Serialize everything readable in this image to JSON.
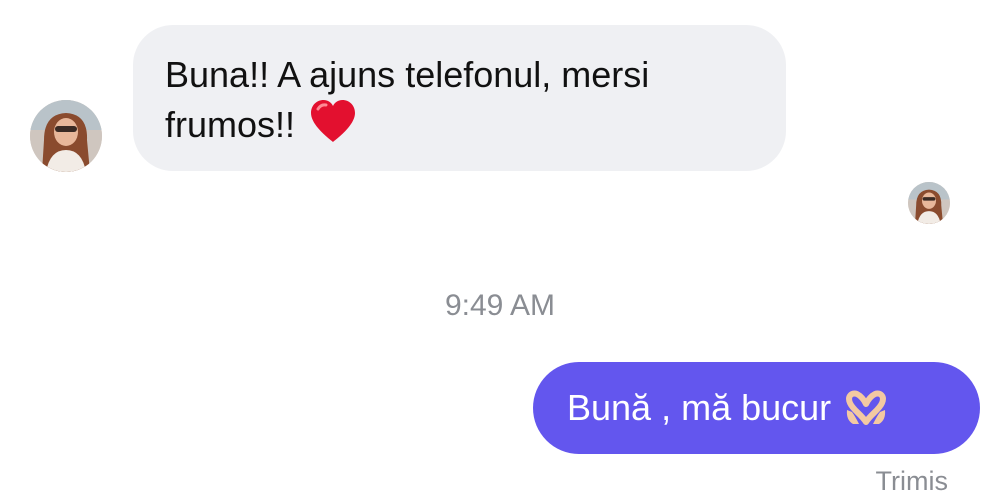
{
  "conversation": {
    "incoming": {
      "line1": "Buna!! A ajuns telefonul, mersi",
      "line2": "frumos!!",
      "emoji": "heart-icon"
    },
    "timestamp": "9:49 AM",
    "outgoing": {
      "text": "Bună , mă bucur",
      "emoji": "heart-hands-icon"
    },
    "status": "Trimis"
  },
  "colors": {
    "incoming_bubble": "#eff0f3",
    "outgoing_bubble": "#6356ee",
    "meta_text": "#8a8d93"
  }
}
